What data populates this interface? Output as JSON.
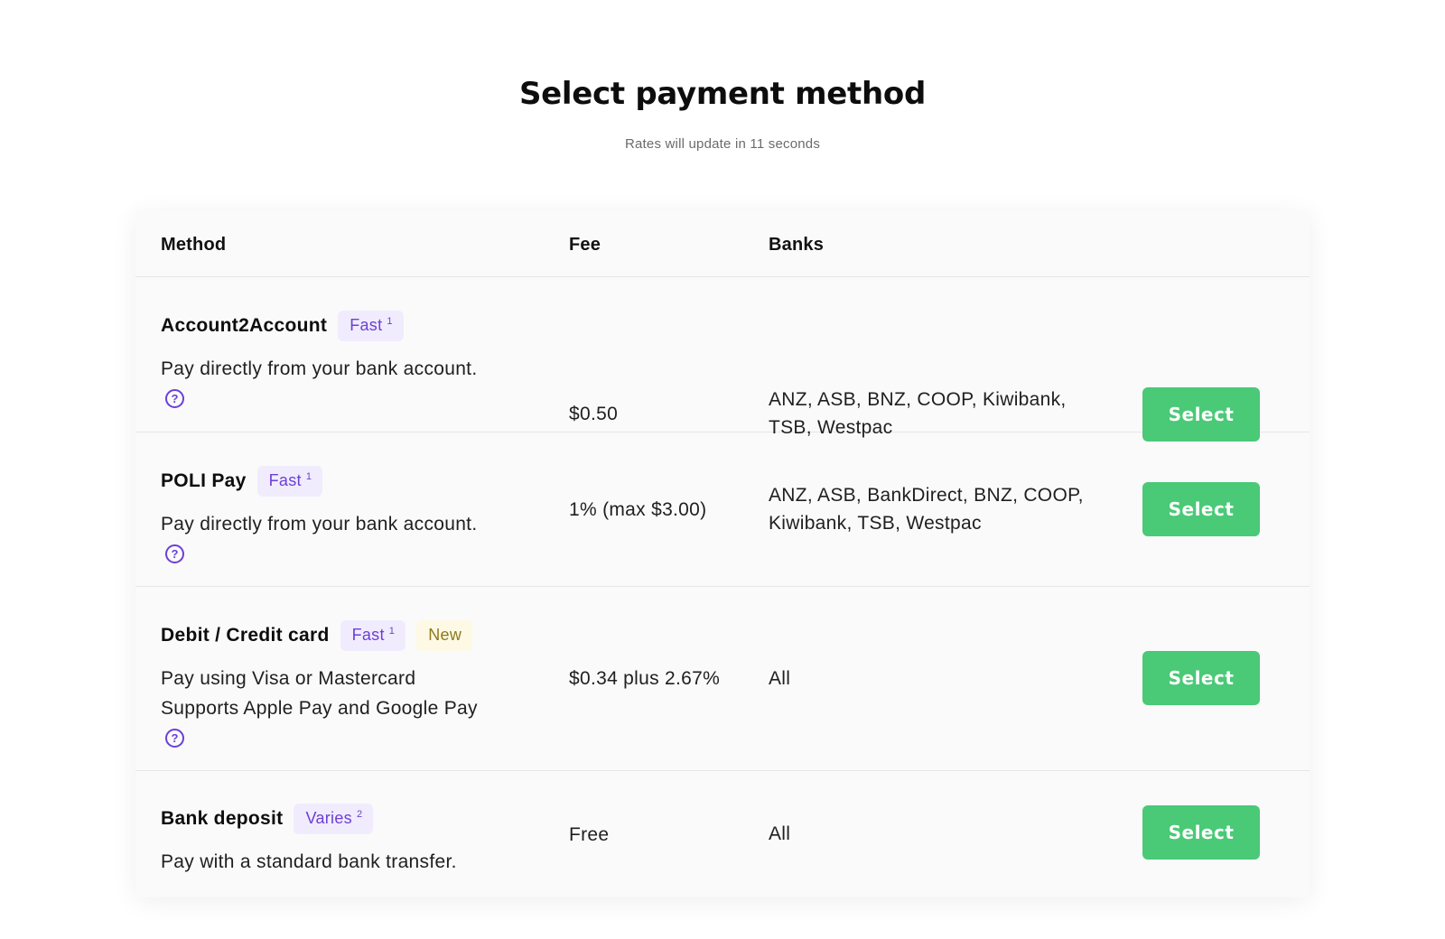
{
  "header": {
    "title": "Select payment method",
    "subtitle": "Rates will update in 11 seconds"
  },
  "table": {
    "columns": [
      "Method",
      "Fee",
      "Banks"
    ],
    "rows": [
      {
        "name": "Account2Account",
        "badges": [
          {
            "label": "Fast",
            "note": "1",
            "style": "fast"
          }
        ],
        "description": [
          "Pay directly from your bank account."
        ],
        "help_icon": "question-circle-icon",
        "fee": "$0.50",
        "banks": "ANZ, ASB, BNZ, COOP, Kiwibank, TSB, Westpac",
        "action": "Select"
      },
      {
        "name": "POLI Pay",
        "badges": [
          {
            "label": "Fast",
            "note": "1",
            "style": "fast"
          }
        ],
        "description": [
          "Pay directly from your bank account."
        ],
        "help_icon": "question-circle-icon",
        "fee": "1% (max $3.00)",
        "banks": "ANZ, ASB, BankDirect, BNZ, COOP, Kiwibank, TSB, Westpac",
        "action": "Select"
      },
      {
        "name": "Debit / Credit card",
        "badges": [
          {
            "label": "Fast",
            "note": "1",
            "style": "fast"
          },
          {
            "label": "New",
            "note": "",
            "style": "new"
          }
        ],
        "description": [
          "Pay using Visa or Mastercard",
          "Supports Apple Pay and Google Pay"
        ],
        "help_icon": "question-circle-icon",
        "fee": "$0.34 plus 2.67%",
        "banks": "All",
        "action": "Select"
      },
      {
        "name": "Bank deposit",
        "badges": [
          {
            "label": "Varies",
            "note": "2",
            "style": "fast"
          }
        ],
        "description": [
          "Pay with a standard bank transfer."
        ],
        "help_icon": "",
        "fee": "Free",
        "banks": "All",
        "action": "Select"
      }
    ]
  },
  "colors": {
    "accent_purple": "#6c3fd6",
    "badge_fast_bg": "#f1ecfd",
    "badge_new_bg": "#fdf9e4",
    "button_green": "#4ac977"
  }
}
